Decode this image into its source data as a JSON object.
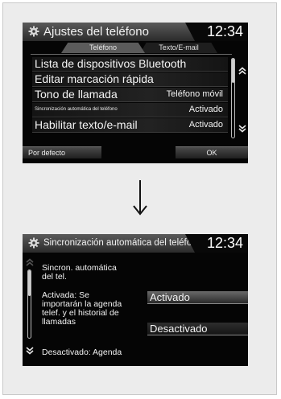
{
  "screen1": {
    "title": "Ajustes del teléfono",
    "clock": "12:34",
    "tabs": [
      {
        "label": "Teléfono",
        "active": true
      },
      {
        "label": "Texto/E-mail",
        "active": false
      }
    ],
    "rows": [
      {
        "label": "Lista de dispositivos Bluetooth",
        "value": ""
      },
      {
        "label": "Editar marcación rápida",
        "value": ""
      },
      {
        "label": "Tono de llamada",
        "value": "Teléfono móvil"
      },
      {
        "label": "Sincronización automática del teléfono",
        "value": "Activado"
      },
      {
        "label": "Habilitar texto/e-mail",
        "value": "Activado"
      }
    ],
    "buttons": {
      "default": "Por defecto",
      "ok": "OK"
    }
  },
  "screen2": {
    "title": "Sincronización automática del teléfono",
    "clock": "12:34",
    "description": [
      "Sincron. automática",
      "del tel.",
      "Activada: Se",
      "importarán la agenda",
      "telef. y el historial de",
      "llamadas",
      "Desactivado: Agenda"
    ],
    "options": [
      {
        "label": "Activado",
        "selected": true
      },
      {
        "label": "Desactivado",
        "selected": false
      }
    ]
  },
  "icons": {
    "settings": "gear-icon",
    "scroll_up": "double-chevron-up-icon",
    "scroll_down": "double-chevron-down-icon",
    "transition": "arrow-down-icon"
  }
}
